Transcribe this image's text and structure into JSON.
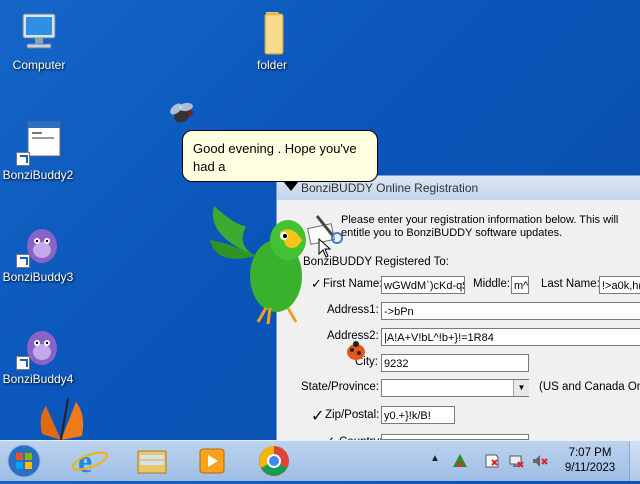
{
  "desktop": {
    "icons": [
      {
        "label": "Computer",
        "icon": "computer-icon"
      },
      {
        "label": "folder",
        "icon": "folder-icon"
      },
      {
        "label": "BonziBuddy2",
        "icon": "app-window-icon"
      },
      {
        "label": "BonziBuddy3",
        "icon": "purple-gorilla-icon"
      },
      {
        "label": "BonziBuddy4",
        "icon": "purple-gorilla-icon"
      }
    ]
  },
  "bubble": {
    "text": "Good evening . Hope you've had a"
  },
  "registration": {
    "title": "BonziBUDDY Online Registration",
    "intro": "Please enter your registration information below.  This will entitle you to BonziBUDDY software updates.",
    "section": "BonziBUDDY Registered To:",
    "labels": {
      "first": "First Name:",
      "middle": "Middle:",
      "last": "Last Name:",
      "address1": "Address1:",
      "address2": "Address2:",
      "city": "City:",
      "state": "State/Province:",
      "state_note": "(US and Canada Onl",
      "zip": "Zip/Postal:",
      "country": "Country:"
    },
    "values": {
      "first": "wGWdM`)cKd-q$",
      "middle": "m^",
      "last": "!>a0k,h(",
      "address1": "->bPn",
      "address2": "|A!A+V!bL^!b+}!=1R84",
      "city": "9232",
      "state": "",
      "zip": "y0.+}!k/B!",
      "country": ""
    }
  },
  "taskbar": {
    "time": "7:07 PM",
    "date": "9/11/2023"
  }
}
